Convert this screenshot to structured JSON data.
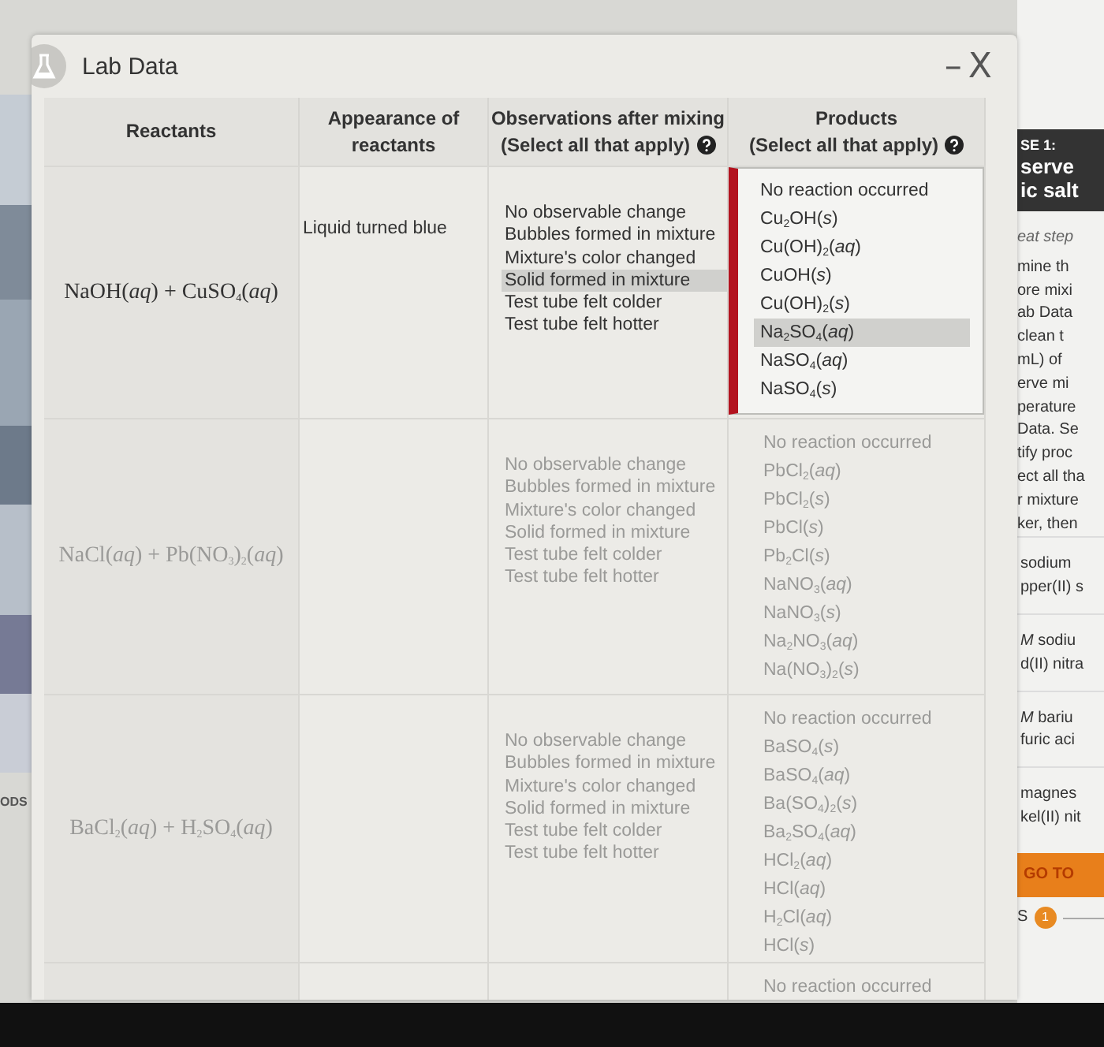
{
  "left_strip": {
    "label": "ODS"
  },
  "window": {
    "title": "Lab Data",
    "minimize": "–",
    "close": "X"
  },
  "table": {
    "columns": [
      {
        "label": "Reactants"
      },
      {
        "label": "Appearance of reactants"
      },
      {
        "label": "Observations after mixing",
        "hint": "(Select all that apply)",
        "help": true
      },
      {
        "label": "Products",
        "hint": "(Select all that apply)",
        "help": true
      }
    ],
    "rows": [
      {
        "reactants": "NaOH(*aq*) + CuSO$_{4}$(*aq*)",
        "appearance": "Liquid turned blue",
        "active": true,
        "observations": [
          {
            "label": "No observable change",
            "selected": false
          },
          {
            "label": "Bubbles formed in mixture",
            "selected": false
          },
          {
            "label": "Mixture's color changed",
            "selected": false
          },
          {
            "label": "Solid formed in mixture",
            "selected": true
          },
          {
            "label": "Test tube felt colder",
            "selected": false
          },
          {
            "label": "Test tube felt hotter",
            "selected": false
          }
        ],
        "products": [
          {
            "label": "No reaction occurred",
            "selected": false
          },
          {
            "label": "Cu$_{2}$OH(*s*)",
            "selected": false
          },
          {
            "label": "Cu(OH)$_{2}$(*aq*)",
            "selected": false
          },
          {
            "label": "CuOH(*s*)",
            "selected": false
          },
          {
            "label": "Cu(OH)$_{2}$(*s*)",
            "selected": false
          },
          {
            "label": "Na$_{2}$SO$_{4}$(*aq*)",
            "selected": true
          },
          {
            "label": "NaSO$_{4}$(*aq*)",
            "selected": false
          },
          {
            "label": "NaSO$_{4}$(*s*)",
            "selected": false
          }
        ]
      },
      {
        "reactants": "NaCl(*aq*) + Pb(NO$_{3}$)$_{2}$(*aq*)",
        "active": false,
        "observations": [
          {
            "label": "No observable change",
            "selected": false
          },
          {
            "label": "Bubbles formed in mixture",
            "selected": false
          },
          {
            "label": "Mixture's color changed",
            "selected": false
          },
          {
            "label": "Solid formed in mixture",
            "selected": false
          },
          {
            "label": "Test tube felt colder",
            "selected": false
          },
          {
            "label": "Test tube felt hotter",
            "selected": false
          }
        ],
        "products": [
          {
            "label": "No reaction occurred",
            "selected": false
          },
          {
            "label": "PbCl$_{2}$(*aq*)",
            "selected": false
          },
          {
            "label": "PbCl$_{2}$(*s*)",
            "selected": false
          },
          {
            "label": "PbCl(*s*)",
            "selected": false
          },
          {
            "label": "Pb$_{2}$Cl(*s*)",
            "selected": false
          },
          {
            "label": "NaNO$_{3}$(*aq*)",
            "selected": false
          },
          {
            "label": "NaNO$_{3}$(*s*)",
            "selected": false
          },
          {
            "label": "Na$_{2}$NO$_{3}$(*aq*)",
            "selected": false
          },
          {
            "label": "Na(NO$_{3}$)$_{2}$(*s*)",
            "selected": false
          }
        ]
      },
      {
        "reactants": "BaCl$_{2}$(*aq*) + H$_{2}$SO$_{4}$(*aq*)",
        "active": false,
        "observations": [
          {
            "label": "No observable change",
            "selected": false
          },
          {
            "label": "Bubbles formed in mixture",
            "selected": false
          },
          {
            "label": "Mixture's color changed",
            "selected": false
          },
          {
            "label": "Solid formed in mixture",
            "selected": false
          },
          {
            "label": "Test tube felt colder",
            "selected": false
          },
          {
            "label": "Test tube felt hotter",
            "selected": false
          }
        ],
        "products": [
          {
            "label": "No reaction occurred",
            "selected": false
          },
          {
            "label": "BaSO$_{4}$(*s*)",
            "selected": false
          },
          {
            "label": "BaSO$_{4}$(*aq*)",
            "selected": false
          },
          {
            "label": "Ba(SO$_{4}$)$_{2}$(*s*)",
            "selected": false
          },
          {
            "label": "Ba$_{2}$SO$_{4}$(*aq*)",
            "selected": false
          },
          {
            "label": "HCl$_{2}$(*aq*)",
            "selected": false
          },
          {
            "label": "HCl(*aq*)",
            "selected": false
          },
          {
            "label": "H$_{2}$Cl(*aq*)",
            "selected": false
          },
          {
            "label": "HCl(*s*)",
            "selected": false
          }
        ]
      },
      {
        "active": false,
        "products": [
          {
            "label": "No reaction occurred",
            "selected": false
          }
        ]
      }
    ]
  },
  "side_panel": {
    "items": [
      {
        "kind": "header",
        "lines": [
          "SE 1:",
          "serve",
          "ic salt"
        ]
      },
      {
        "kind": "note",
        "lines": [
          "eat step"
        ]
      },
      {
        "kind": "paragraph",
        "lines": [
          "mine th",
          "ore mixi",
          "ab Data",
          "clean t",
          "mL) of",
          "erve mi",
          "perature",
          "Data. Se",
          "tify proc",
          "ect all tha",
          "r mixture",
          "ker, then"
        ]
      },
      {
        "kind": "reagent",
        "lines": [
          "sodium",
          "pper(II) s"
        ]
      },
      {
        "kind": "reagent",
        "lines": [
          "*M* sodiu",
          "d(II) nitra"
        ]
      },
      {
        "kind": "reagent",
        "lines": [
          "*M* bariu",
          "furic aci"
        ]
      },
      {
        "kind": "reagent",
        "lines": [
          "magnes",
          "kel(II) nit"
        ]
      },
      {
        "kind": "button",
        "lines": [
          "GO TO"
        ]
      },
      {
        "kind": "progress",
        "lines": [
          "S"
        ],
        "badge": "1"
      }
    ]
  }
}
